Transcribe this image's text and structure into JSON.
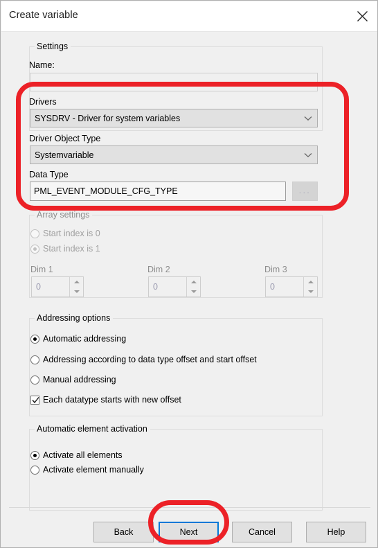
{
  "dialog": {
    "title": "Create variable",
    "close_icon": "close-icon"
  },
  "settings": {
    "group_label": "Settings",
    "name_label": "Name:",
    "name_value": "",
    "drivers_label": "Drivers",
    "drivers_value": "SYSDRV - Driver for system variables",
    "driver_object_type_label": "Driver Object Type",
    "driver_object_type_value": "Systemvariable",
    "data_type_label": "Data Type",
    "data_type_value": "PML_EVENT_MODULE_CFG_TYPE",
    "browse_label": "...",
    "chevron_icon": "chevron-down-icon"
  },
  "array_settings": {
    "group_label": "Array settings",
    "start_index_0_label": "Start index is 0",
    "start_index_1_label": "Start index is 1",
    "start_index_selected": "Start index is 1",
    "dim1_label": "Dim 1",
    "dim1_value": "0",
    "dim2_label": "Dim 2",
    "dim2_value": "0",
    "dim3_label": "Dim 3",
    "dim3_value": "0"
  },
  "addressing_options": {
    "group_label": "Addressing options",
    "option_automatic": "Automatic addressing",
    "option_datatype_offset": "Addressing according to data type offset and start offset",
    "option_manual": "Manual addressing",
    "selected": "Automatic addressing",
    "checkbox_label": "Each datatype starts with new offset",
    "checkbox_checked": true
  },
  "element_activation": {
    "group_label": "Automatic element activation",
    "option_all": "Activate all elements",
    "option_manual": "Activate element manually",
    "selected": "Activate all elements"
  },
  "footer": {
    "back_label": "Back",
    "next_label": "Next",
    "cancel_label": "Cancel",
    "help_label": "Help"
  },
  "annotations": {
    "accent_color": "#ec2127",
    "focus_color": "#0078d7"
  }
}
